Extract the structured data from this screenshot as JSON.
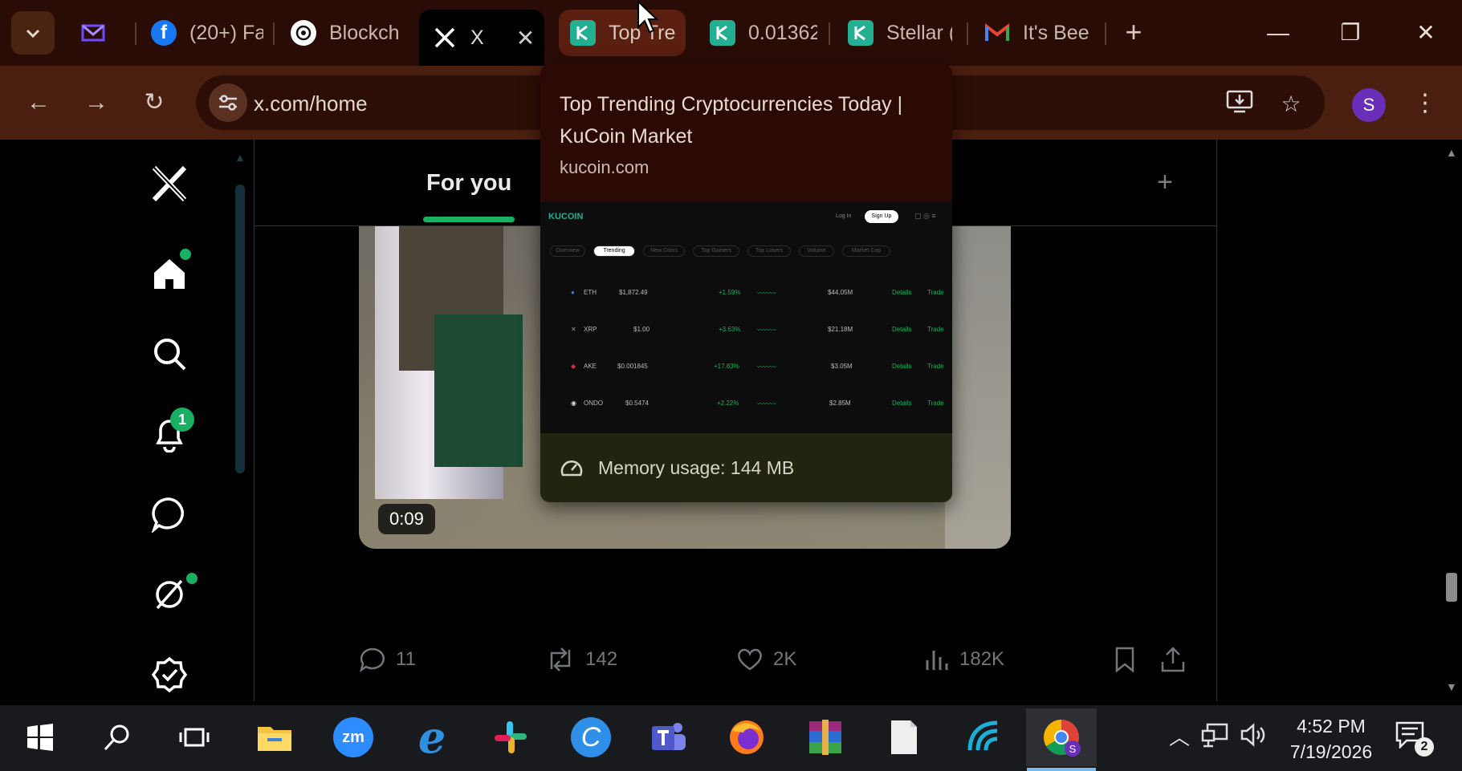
{
  "browser": {
    "tabs": [
      {
        "label": "",
        "favicon": "proton-mail-icon",
        "color": "#6d4aff"
      },
      {
        "label": "(20+) Fa",
        "favicon": "facebook-icon",
        "color": "#1877f2"
      },
      {
        "label": "Blockch",
        "favicon": "openai-icon",
        "color": "#ffffff"
      },
      {
        "label": "X",
        "favicon": "x-icon",
        "color": "#ffffff",
        "active": true
      },
      {
        "label": "Top Tre",
        "favicon": "kucoin-icon",
        "color": "#23af91",
        "hover": true
      },
      {
        "label": "0.01362",
        "favicon": "kucoin-icon",
        "color": "#23af91"
      },
      {
        "label": "Stellar (",
        "favicon": "kucoin-icon",
        "color": "#23af91"
      },
      {
        "label": "It's Beer",
        "favicon": "gmail-icon",
        "color": "#ea4335"
      }
    ],
    "new_tab": "+",
    "address": "x.com/home",
    "avatar_initial": "S"
  },
  "hovercard": {
    "title": "Top Trending Cryptocurrencies Today | KuCoin Market",
    "domain": "kucoin.com",
    "memory": "Memory usage: 144 MB",
    "preview": {
      "logo": "KUCOIN",
      "login": "Log In",
      "signup": "Sign Up",
      "tabs": [
        "Overview",
        "Trending",
        "New Coins",
        "Top Gainers",
        "Top Losers",
        "Volume",
        "Market Cap"
      ],
      "rows": [
        {
          "coin": "ETH",
          "price": "$1,872.49",
          "change": "+1.59%",
          "vol": "$44.05M"
        },
        {
          "coin": "XRP",
          "price": "$1.00",
          "change": "+3.63%",
          "vol": "$21.18M"
        },
        {
          "coin": "AKE",
          "price": "$0.001845",
          "change": "+17.83%",
          "vol": "$3.05M"
        },
        {
          "coin": "ONDO",
          "price": "$0.5474",
          "change": "+2.22%",
          "vol": "$2.85M"
        }
      ],
      "details": "Details",
      "trade": "Trade"
    }
  },
  "x": {
    "tab_for_you": "For you",
    "video_duration": "0:09",
    "notification_count": "1",
    "stats": {
      "replies": "11",
      "reposts": "142",
      "likes": "2K",
      "views": "182K"
    },
    "accent": "#1ab063"
  },
  "taskbar": {
    "time": "4:52 PM",
    "date": "7/19/2026",
    "notifications": "2",
    "apps": [
      "windows-start-icon",
      "search-icon",
      "task-view-icon",
      "file-explorer-icon",
      "zoom-icon",
      "internet-explorer-icon",
      "slack-icon",
      "ccleaner-icon",
      "teams-icon",
      "firefox-icon",
      "winrar-icon",
      "file-icon",
      "wireshark-icon",
      "chrome-icon"
    ]
  }
}
